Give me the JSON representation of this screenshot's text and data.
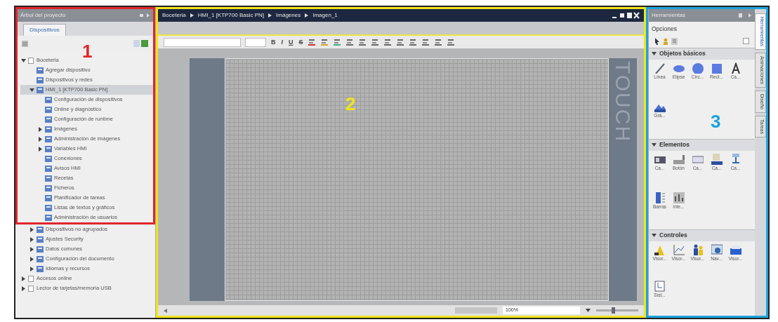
{
  "project_tree": {
    "title": "Árbol del proyecto",
    "tabs": [
      {
        "label": "Dispositivos",
        "selected": true
      }
    ],
    "items": [
      {
        "label": "Boceteria",
        "expanded": true,
        "selected": false,
        "children": [
          {
            "label": "Agregar dispositivo",
            "selected": false
          },
          {
            "label": "Dispositivos y redes",
            "selected": false
          },
          {
            "label": "HMI_1 [KTP700 Basic PN]",
            "expanded": true,
            "selected": true,
            "children": [
              {
                "label": "Configuración de dispositivos",
                "selected": false
              },
              {
                "label": "Online y diagnóstico",
                "selected": false
              },
              {
                "label": "Configuración de runtime",
                "selected": false
              },
              {
                "label": "Imágenes",
                "expanded": false,
                "selected": false
              },
              {
                "label": "Administración de imágenes",
                "expanded": false,
                "selected": false
              },
              {
                "label": "Variables HMI",
                "expanded": false,
                "selected": false
              },
              {
                "label": "Conexiones",
                "selected": false
              },
              {
                "label": "Avisos HMI",
                "selected": false
              },
              {
                "label": "Recetas",
                "selected": false
              },
              {
                "label": "Ficheros",
                "selected": false
              },
              {
                "label": "Planificador de tareas",
                "selected": false
              },
              {
                "label": "Listas de textos y gráficos",
                "selected": false
              },
              {
                "label": "Administración de usuarios",
                "selected": false
              }
            ]
          },
          {
            "label": "Dispositivos no agrupados",
            "expanded": false,
            "selected": false
          },
          {
            "label": "Ajustes Security",
            "expanded": false,
            "selected": false
          },
          {
            "label": "Datos comunes",
            "expanded": false,
            "selected": false
          },
          {
            "label": "Configuración del documento",
            "expanded": false,
            "selected": false
          },
          {
            "label": "Idiomas y recursos",
            "expanded": false,
            "selected": false
          }
        ]
      },
      {
        "label": "Accesos online",
        "expanded": false,
        "selected": false
      },
      {
        "label": "Lector de tarjetas/memoria USB",
        "expanded": false,
        "selected": false
      }
    ]
  },
  "editor": {
    "breadcrumb": [
      "Boceteria",
      "HMI_1 [KTP700 Basic PN]",
      "Imágenes",
      "Imagen_1"
    ],
    "format_buttons": [
      "B",
      "I",
      "U",
      "S"
    ],
    "panel_label": "TOUCH",
    "zoom": "100%",
    "zoom_slider": {
      "level": 0.4
    }
  },
  "tools": {
    "title": "Herramientas",
    "options_label": "Opciones",
    "sections": [
      {
        "title": "Objetos básicos",
        "expanded": true,
        "items": [
          "Línea",
          "Elipse",
          "Círc...",
          "Rect...",
          "Ca...",
          "Grá..."
        ]
      },
      {
        "title": "Elementos",
        "expanded": true,
        "items": [
          "Ca...",
          "Botón",
          "Ca...",
          "Ca...",
          "Ca...",
          "Barras",
          "Inte..."
        ]
      },
      {
        "title": "Controles",
        "expanded": true,
        "items": [
          "Visor...",
          "Visor...",
          "Visor...",
          "Nav...",
          "Visor...",
          "Sist..."
        ]
      }
    ],
    "side_tabs": [
      {
        "label": "Herramientas",
        "selected": true
      },
      {
        "label": "Animaciones",
        "selected": false
      },
      {
        "label": "Diseño",
        "selected": false
      },
      {
        "label": "Tareas",
        "selected": false
      }
    ]
  },
  "callouts": [
    {
      "label": "1",
      "color": "#e0262c"
    },
    {
      "label": "2",
      "color": "#f2e41c"
    },
    {
      "label": "3",
      "color": "#1ba4dd"
    }
  ]
}
